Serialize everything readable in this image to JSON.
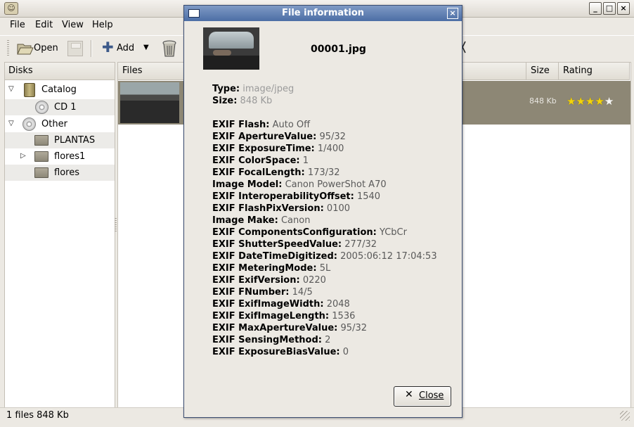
{
  "menu": {
    "file": "File",
    "edit": "Edit",
    "view": "View",
    "help": "Help"
  },
  "toolbar": {
    "open_label": "Open",
    "add_label": "Add"
  },
  "disks": {
    "header": "Disks",
    "tree": [
      {
        "label": "Catalog",
        "icon": "catalog-icon"
      },
      {
        "label": "CD 1",
        "icon": "cd-icon"
      },
      {
        "label": "Other",
        "icon": "cd-icon"
      },
      {
        "label": "PLANTAS",
        "icon": "folder-icon"
      },
      {
        "label": "flores1",
        "icon": "folder-icon"
      },
      {
        "label": "flores",
        "icon": "folder-icon"
      }
    ]
  },
  "files": {
    "columns": {
      "files": "Files",
      "size": "Size",
      "rating": "Rating"
    },
    "row": {
      "size": "848 Kb",
      "rating": 4,
      "rating_max": 5
    }
  },
  "status": {
    "text": "1 files 848 Kb"
  },
  "dialog": {
    "title": "File information",
    "filename": "00001.jpg",
    "close_label": "Close",
    "info": [
      {
        "key": "Type:",
        "value": "image/jpeg"
      },
      {
        "key": "Size:",
        "value": "848 Kb"
      },
      {
        "key": "EXIF Flash:",
        "value": "Auto Off"
      },
      {
        "key": "EXIF ApertureValue:",
        "value": "95/32"
      },
      {
        "key": "EXIF ExposureTime:",
        "value": "1/400"
      },
      {
        "key": "EXIF ColorSpace:",
        "value": "1"
      },
      {
        "key": "EXIF FocalLength:",
        "value": "173/32"
      },
      {
        "key": "Image Model:",
        "value": "Canon PowerShot A70"
      },
      {
        "key": "EXIF InteroperabilityOffset:",
        "value": "1540"
      },
      {
        "key": "EXIF FlashPixVersion:",
        "value": "0100"
      },
      {
        "key": "Image Make:",
        "value": "Canon"
      },
      {
        "key": "EXIF ComponentsConfiguration:",
        "value": "YCbCr"
      },
      {
        "key": "EXIF ShutterSpeedValue:",
        "value": "277/32"
      },
      {
        "key": "EXIF DateTimeDigitized:",
        "value": "2005:06:12 17:04:53"
      },
      {
        "key": "EXIF MeteringMode:",
        "value": "5L"
      },
      {
        "key": "EXIF ExifVersion:",
        "value": "0220"
      },
      {
        "key": "EXIF FNumber:",
        "value": "14/5"
      },
      {
        "key": "EXIF ExifImageWidth:",
        "value": "2048"
      },
      {
        "key": "EXIF ExifImageLength:",
        "value": "1536"
      },
      {
        "key": "EXIF MaxApertureValue:",
        "value": "95/32"
      },
      {
        "key": "EXIF SensingMethod:",
        "value": "2"
      },
      {
        "key": "EXIF ExposureBiasValue:",
        "value": "0"
      }
    ]
  }
}
